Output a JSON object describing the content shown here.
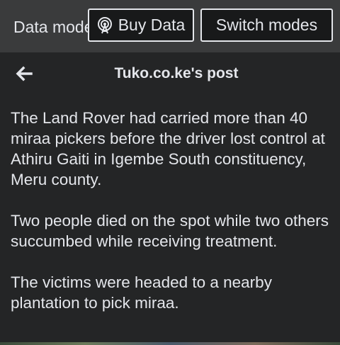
{
  "topbar": {
    "mode_label": "Data mode",
    "buy_data_label": "Buy Data",
    "buy_data_icon": "broadcast-tower-icon",
    "switch_modes_label": "Switch modes"
  },
  "header": {
    "back_icon": "arrow-left-icon",
    "title": "Tuko.co.ke's post"
  },
  "post": {
    "paragraphs": [
      "The Land Rover had carried more than 40 miraa pickers before the driver lost control at Athiru Gaiti in Igembe South constituency, Meru county.",
      "Two people died on the spot while two others succumbed while receiving treatment.",
      "The victims were headed to a nearby plantation to pick miraa."
    ]
  },
  "colors": {
    "background": "#242526",
    "topbar": "#3a3b3c",
    "text": "#e4e6eb"
  }
}
